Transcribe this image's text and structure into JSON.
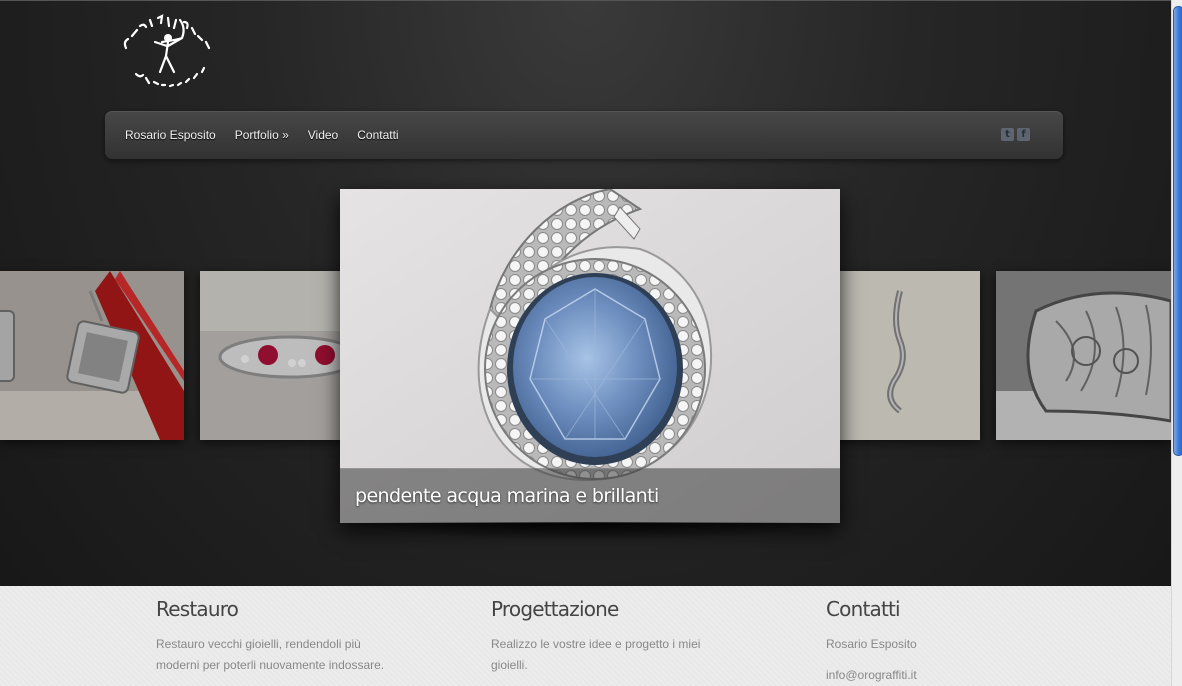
{
  "logo": {
    "alt": "Orograffiti gioielli",
    "brand_color": "#ffffff"
  },
  "nav": {
    "items": [
      {
        "label": "Rosario Esposito"
      },
      {
        "label": "Portfolio »"
      },
      {
        "label": "Video"
      },
      {
        "label": "Contatti"
      }
    ],
    "social": [
      {
        "icon": "twitter-icon",
        "glyph": "t"
      },
      {
        "icon": "facebook-icon",
        "glyph": "f"
      }
    ]
  },
  "slider": {
    "caption": "pendente acqua marina e brillanti"
  },
  "footer": {
    "columns": [
      {
        "title": "Restauro",
        "lines": [
          "Restauro vecchi gioielli, rendendoli più",
          "moderni per poterli nuovamente indossare."
        ]
      },
      {
        "title": "Progettazione",
        "lines": [
          "Realizzo le vostre idee e progetto i miei",
          "gioielli."
        ]
      },
      {
        "title": "Contatti",
        "lines": [
          "Rosario Esposito",
          "info@orograffiti.it"
        ]
      }
    ]
  },
  "colors": {
    "nav_bg": "#3c3c3c",
    "footer_bg": "#ececec",
    "scroll_thumb": "#3f7bd6"
  }
}
